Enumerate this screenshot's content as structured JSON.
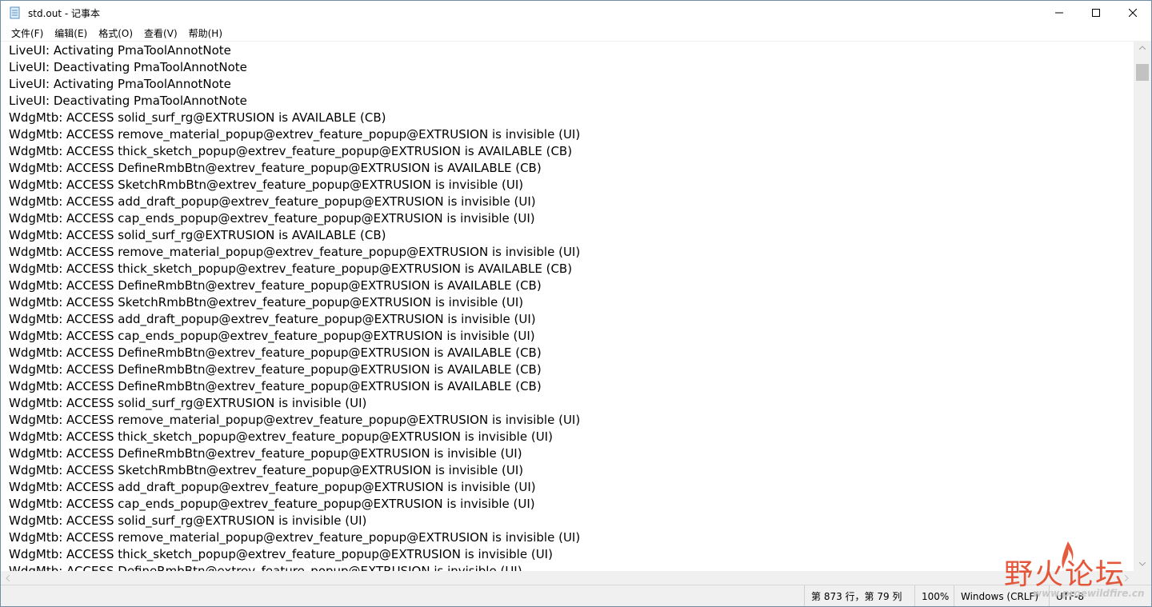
{
  "window": {
    "title": "std.out - 记事本"
  },
  "menu": [
    "文件(F)",
    "编辑(E)",
    "格式(O)",
    "查看(V)",
    "帮助(H)"
  ],
  "lines": [
    "LiveUI: Activating PmaToolAnnotNote",
    "LiveUI: Deactivating PmaToolAnnotNote",
    "LiveUI: Activating PmaToolAnnotNote",
    "LiveUI: Deactivating PmaToolAnnotNote",
    "WdgMtb: ACCESS solid_surf_rg@EXTRUSION is AVAILABLE (CB)",
    "WdgMtb: ACCESS remove_material_popup@extrev_feature_popup@EXTRUSION is invisible (UI)",
    "WdgMtb: ACCESS thick_sketch_popup@extrev_feature_popup@EXTRUSION is AVAILABLE (CB)",
    "WdgMtb: ACCESS DefineRmbBtn@extrev_feature_popup@EXTRUSION is AVAILABLE (CB)",
    "WdgMtb: ACCESS SketchRmbBtn@extrev_feature_popup@EXTRUSION is invisible (UI)",
    "WdgMtb: ACCESS add_draft_popup@extrev_feature_popup@EXTRUSION is invisible (UI)",
    "WdgMtb: ACCESS cap_ends_popup@extrev_feature_popup@EXTRUSION is invisible (UI)",
    "WdgMtb: ACCESS solid_surf_rg@EXTRUSION is AVAILABLE (CB)",
    "WdgMtb: ACCESS remove_material_popup@extrev_feature_popup@EXTRUSION is invisible (UI)",
    "WdgMtb: ACCESS thick_sketch_popup@extrev_feature_popup@EXTRUSION is AVAILABLE (CB)",
    "WdgMtb: ACCESS DefineRmbBtn@extrev_feature_popup@EXTRUSION is AVAILABLE (CB)",
    "WdgMtb: ACCESS SketchRmbBtn@extrev_feature_popup@EXTRUSION is invisible (UI)",
    "WdgMtb: ACCESS add_draft_popup@extrev_feature_popup@EXTRUSION is invisible (UI)",
    "WdgMtb: ACCESS cap_ends_popup@extrev_feature_popup@EXTRUSION is invisible (UI)",
    "WdgMtb: ACCESS DefineRmbBtn@extrev_feature_popup@EXTRUSION is AVAILABLE (CB)",
    "WdgMtb: ACCESS DefineRmbBtn@extrev_feature_popup@EXTRUSION is AVAILABLE (CB)",
    "WdgMtb: ACCESS DefineRmbBtn@extrev_feature_popup@EXTRUSION is AVAILABLE (CB)",
    "WdgMtb: ACCESS solid_surf_rg@EXTRUSION is invisible (UI)",
    "WdgMtb: ACCESS remove_material_popup@extrev_feature_popup@EXTRUSION is invisible (UI)",
    "WdgMtb: ACCESS thick_sketch_popup@extrev_feature_popup@EXTRUSION is invisible (UI)",
    "WdgMtb: ACCESS DefineRmbBtn@extrev_feature_popup@EXTRUSION is invisible (UI)",
    "WdgMtb: ACCESS SketchRmbBtn@extrev_feature_popup@EXTRUSION is invisible (UI)",
    "WdgMtb: ACCESS add_draft_popup@extrev_feature_popup@EXTRUSION is invisible (UI)",
    "WdgMtb: ACCESS cap_ends_popup@extrev_feature_popup@EXTRUSION is invisible (UI)",
    "WdgMtb: ACCESS solid_surf_rg@EXTRUSION is invisible (UI)",
    "WdgMtb: ACCESS remove_material_popup@extrev_feature_popup@EXTRUSION is invisible (UI)",
    "WdgMtb: ACCESS thick_sketch_popup@extrev_feature_popup@EXTRUSION is invisible (UI)",
    "WdgMtb: ACCESS DefineRmbBtn@extrev_feature_popup@EXTRUSION is invisible (UI)"
  ],
  "scroll": {
    "vertical_position": 0.02
  },
  "status": {
    "position": "第 873 行，第 79 列",
    "zoom": "100%",
    "line_ending": "Windows (CRLF)",
    "encoding": "UTF-8"
  },
  "watermark": {
    "text": "野火论坛",
    "url": "www.proewildfire.cn"
  },
  "colors": {
    "window_border": "#6f8ea6",
    "scrollbar_bg": "#f0f0f0",
    "scroll_thumb": "#c2c2c2",
    "watermark_red": "#e2492a"
  },
  "icons": {
    "app": "notepad-icon",
    "minimize": "minimize-icon",
    "maximize": "maximize-icon",
    "close": "close-icon"
  }
}
